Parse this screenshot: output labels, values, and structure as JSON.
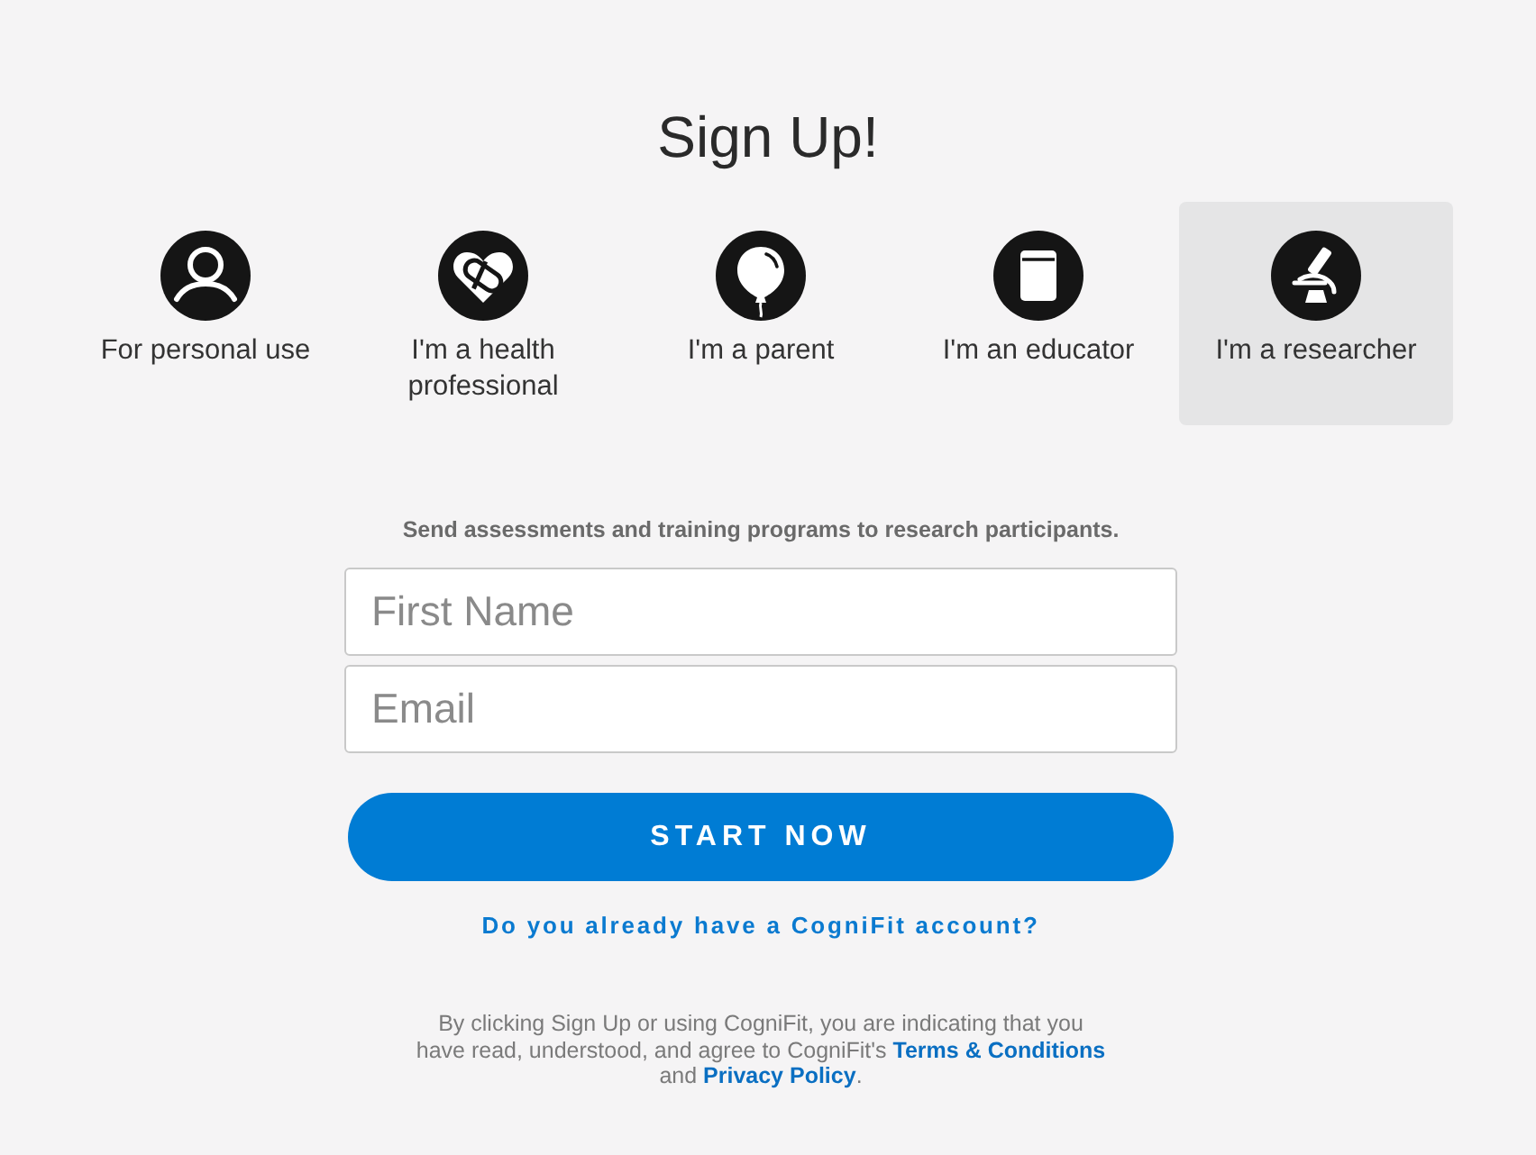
{
  "title": "Sign Up!",
  "options": [
    {
      "label": "For personal use",
      "selected": false
    },
    {
      "label": "I'm a health professional",
      "selected": false
    },
    {
      "label": "I'm a parent",
      "selected": false
    },
    {
      "label": "I'm an educator",
      "selected": false
    },
    {
      "label": "I'm a researcher",
      "selected": true
    }
  ],
  "description": "Send assessments and training programs to research participants.",
  "fields": [
    {
      "placeholder": "First Name"
    },
    {
      "placeholder": "Email"
    }
  ],
  "submit_button": "START NOW",
  "login_link": "Do you already have a CogniFit account?",
  "legal": [
    {
      "kind": "text",
      "text": "By clicking Sign Up or using CogniFit, you are indicating that you have read, understood, and agree to CogniFit's"
    },
    {
      "kind": "link",
      "text": "Terms & Conditions"
    },
    {
      "kind": "text",
      "text": "and"
    },
    {
      "kind": "link",
      "text": "Privacy Policy"
    },
    {
      "kind": "text",
      "text": "."
    }
  ]
}
